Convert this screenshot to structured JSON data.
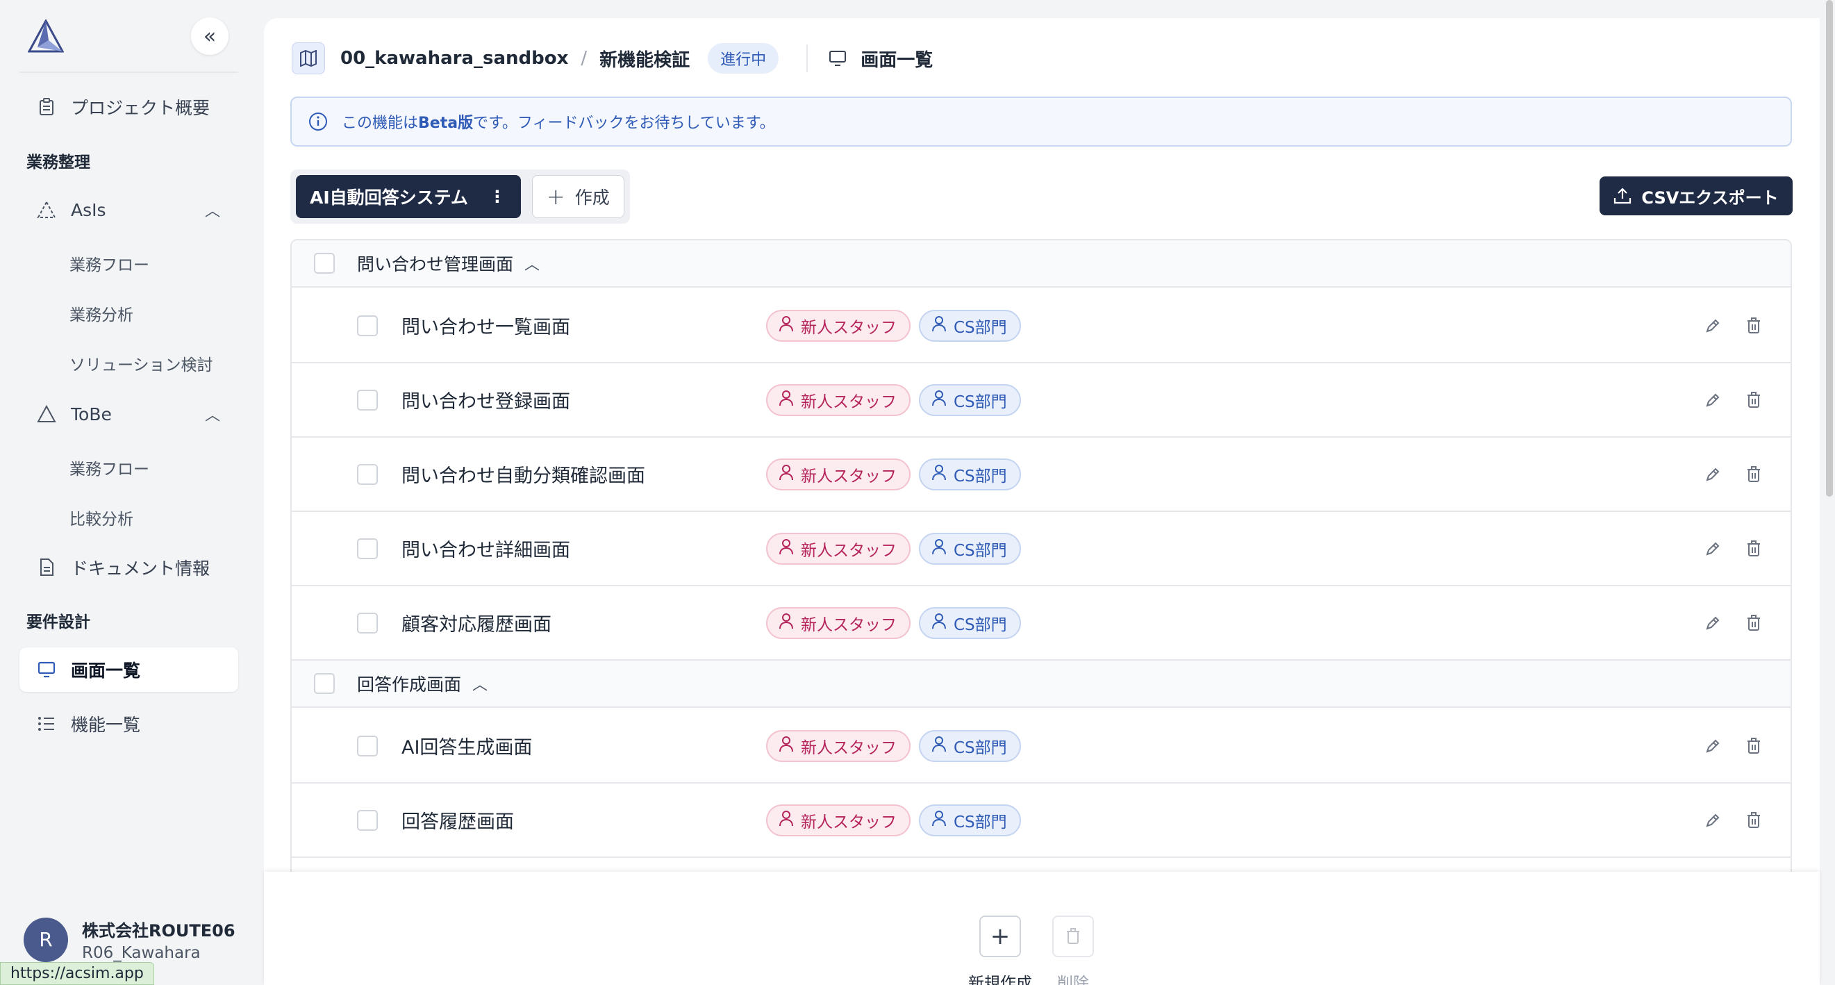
{
  "sidebar": {
    "project_overview": "プロジェクト概要",
    "section_business": "業務整理",
    "asis": {
      "label": "AsIs",
      "items": [
        "業務フロー",
        "業務分析",
        "ソリューション検討"
      ]
    },
    "tobe": {
      "label": "ToBe",
      "items": [
        "業務フロー",
        "比較分析"
      ]
    },
    "document_info": "ドキュメント情報",
    "section_requirements": "要件設計",
    "screen_list": "画面一覧",
    "function_list": "機能一覧",
    "user": {
      "initial": "R",
      "org": "株式会社ROUTE06",
      "name": "R06_Kawahara"
    }
  },
  "status_url": "https://acsim.app",
  "header": {
    "project": "00_kawahara_sandbox",
    "feature": "新機能検証",
    "status": "進行中",
    "page_title": "画面一覧"
  },
  "banner": {
    "prefix": "この機能は",
    "bold": "Beta版",
    "suffix": "です。フィードバックをお待ちしています。"
  },
  "tabs": {
    "active": "AI自動回答システム",
    "dots": "⋮",
    "create": "作成"
  },
  "csv_export": "CSVエクスポート",
  "groups": [
    {
      "label": "問い合わせ管理画面",
      "items": [
        {
          "label": "問い合わせ一覧画面",
          "tags": [
            "新人スタッフ",
            "CS部門"
          ]
        },
        {
          "label": "問い合わせ登録画面",
          "tags": [
            "新人スタッフ",
            "CS部門"
          ]
        },
        {
          "label": "問い合わせ自動分類確認画面",
          "tags": [
            "新人スタッフ",
            "CS部門"
          ]
        },
        {
          "label": "問い合わせ詳細画面",
          "tags": [
            "新人スタッフ",
            "CS部門"
          ]
        },
        {
          "label": "顧客対応履歴画面",
          "tags": [
            "新人スタッフ",
            "CS部門"
          ]
        }
      ]
    },
    {
      "label": "回答作成画面",
      "items": [
        {
          "label": "AI回答生成画面",
          "tags": [
            "新人スタッフ",
            "CS部門"
          ]
        },
        {
          "label": "回答履歴画面",
          "tags": [
            "新人スタッフ",
            "CS部門"
          ]
        }
      ]
    }
  ],
  "bottom_bar": {
    "new": "新規作成",
    "delete": "削除"
  },
  "colors": {
    "primary": "#1f2a44",
    "tag_pink": "#b5245a",
    "tag_blue": "#2f5bb7"
  }
}
